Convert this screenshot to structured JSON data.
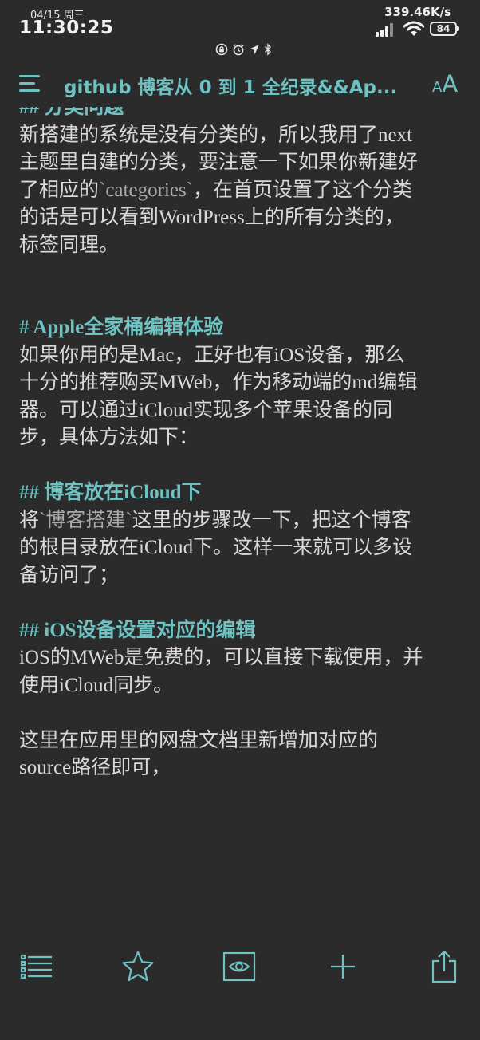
{
  "status_bar": {
    "date": "04/15 周三",
    "time": "11:30:25",
    "network_speed": "339.46K/s",
    "battery": "84",
    "icons": [
      "screen-lock-icon",
      "alarm-icon",
      "location-icon",
      "bluetooth-icon",
      "signal-icon",
      "wifi-icon",
      "battery-icon"
    ]
  },
  "navbar": {
    "title": "github 博客从 0 到 1 全纪录&&Ap...",
    "menu_icon": "hamburger-menu-icon",
    "font_size_icon": "font-size-icon",
    "font_size_small": "A",
    "font_size_big": "A"
  },
  "document": {
    "partial_heading": "## 分类问题",
    "p1": "新搭建的系统是没有分类的，所以我用了next\n主题里自建的分类，要注意一下如果你新建好\n了相应的",
    "p1_code": "`categories`",
    "p1_tail": "，在首页设置了这个分类\n的话是可以看到WordPress上的所有分类的，\n标签同理。",
    "h_apple": "# Apple全家桶编辑体验",
    "p2": "如果你用的是Mac，正好也有iOS设备，那么\n十分的推荐购买MWeb，作为移动端的md编辑\n器。可以通过iCloud实现多个苹果设备的同\n步，具体方法如下：",
    "h_icloud": "## 博客放在iCloud下",
    "p3_head": "将",
    "p3_code": "`博客搭建`",
    "p3": "这里的步骤改一下，把这个博客\n的根目录放在iCloud下。这样一来就可以多设\n备访问了；",
    "h_ios": "## iOS设备设置对应的编辑",
    "p4": "iOS的MWeb是免费的，可以直接下载使用，并\n使用iCloud同步。",
    "p5": "这里在应用里的网盘文档里新增加对应的\nsource路径即可，"
  },
  "toolbar": {
    "items": [
      "outline-list-icon",
      "star-icon",
      "preview-eye-icon",
      "add-icon",
      "share-icon"
    ]
  },
  "colors": {
    "background": "#2b2b2b",
    "accent": "#6fc2c2",
    "text": "#d9d9d9",
    "code_text": "#a9a9a9"
  }
}
